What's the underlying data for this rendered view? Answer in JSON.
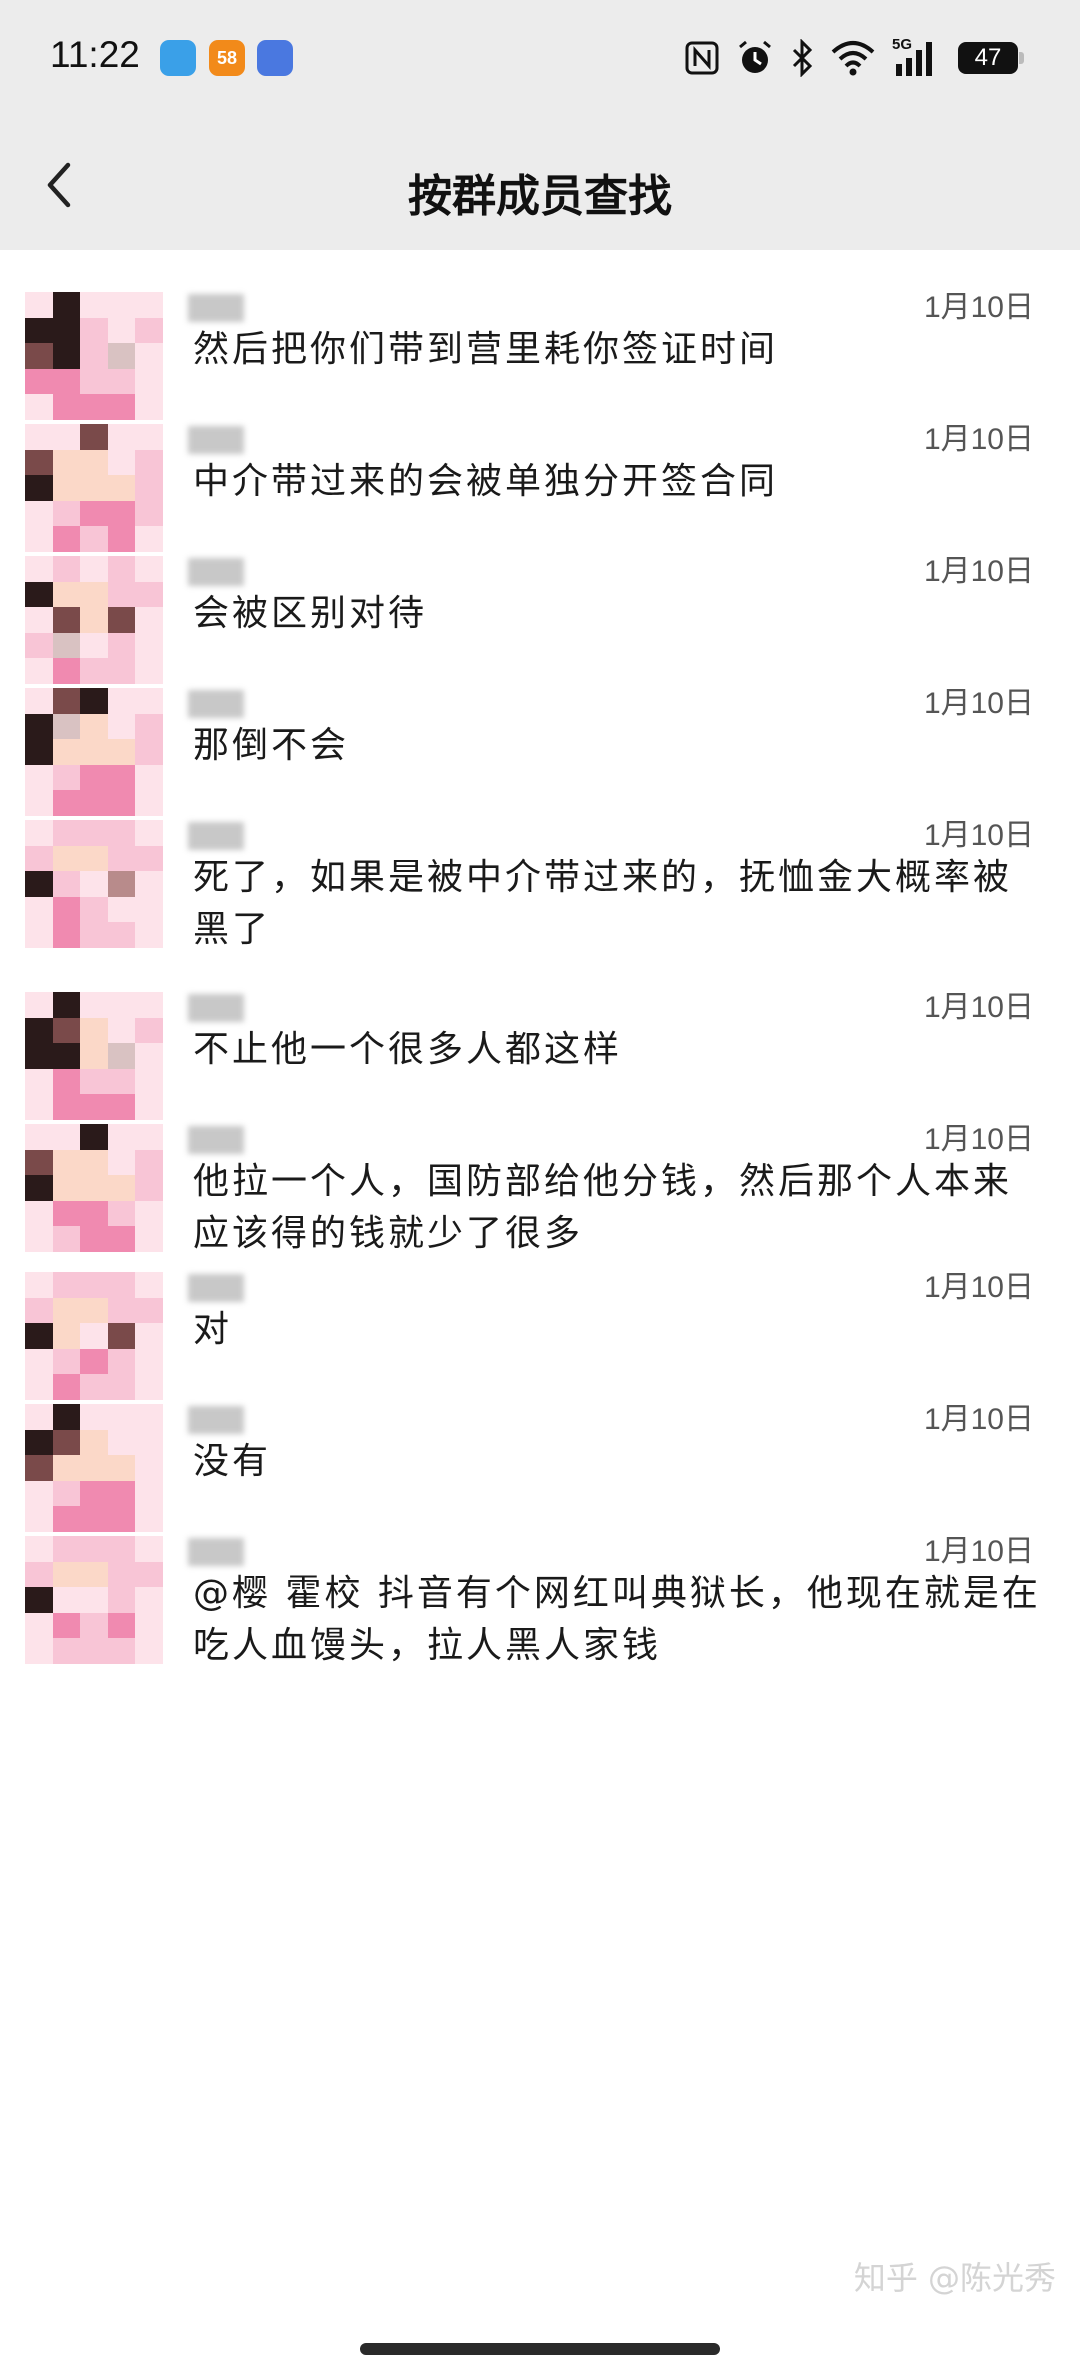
{
  "status_bar": {
    "time": "11:22",
    "apps": [
      {
        "icon": "telegram-send-icon",
        "color": "#3aa0e8",
        "label": ""
      },
      {
        "icon": "58-app-icon",
        "color": "#f28a1a",
        "label": "58"
      },
      {
        "icon": "cloud-app-icon",
        "color": "#4a78e0",
        "label": ""
      }
    ],
    "network_label": "5G",
    "battery": "47",
    "icons": [
      "nfc-icon",
      "alarm-icon",
      "bluetooth-icon",
      "wifi-icon",
      "signal-icon",
      "battery-icon"
    ]
  },
  "header": {
    "title": "按群成员查找",
    "back_icon": "chevron-left-icon"
  },
  "messages": [
    {
      "date": "1月10日",
      "text": "然后把你们带到营里耗你签证时间"
    },
    {
      "date": "1月10日",
      "text": "中介带过来的会被单独分开签合同"
    },
    {
      "date": "1月10日",
      "text": "会被区别对待"
    },
    {
      "date": "1月10日",
      "text": "那倒不会"
    },
    {
      "date": "1月10日",
      "text": "死了，如果是被中介带过来的，抚恤金大概率被黑了"
    },
    {
      "date": "1月10日",
      "text": "不止他一个很多人都这样"
    },
    {
      "date": "1月10日",
      "text": "他拉一个人，国防部给他分钱，然后那个人本来应该得的钱就少了很多"
    },
    {
      "date": "1月10日",
      "text": "对"
    },
    {
      "date": "1月10日",
      "text": "没有"
    },
    {
      "date": "1月10日",
      "text": "@樱  霍校 抖音有个网红叫典狱长，他现在就是在吃人血馒头，拉人黑人家钱"
    }
  ],
  "watermark": "知乎 @陈光秀",
  "colors": {
    "header_bg": "#ececec",
    "avatar_palette": [
      "#fde3ea",
      "#f8c5d6",
      "#f08ab0",
      "#2a1a1a",
      "#7a4a4a",
      "#d9c2c2",
      "#fbd8c8",
      "#b88b8b"
    ]
  }
}
